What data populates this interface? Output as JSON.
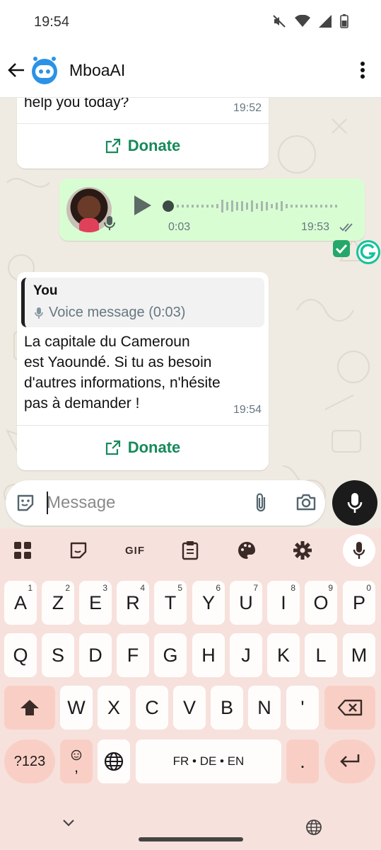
{
  "status_bar": {
    "time": "19:54"
  },
  "header": {
    "title": "MboaAI"
  },
  "messages": {
    "first": {
      "text_fragment": "help you today?",
      "time": "19:52",
      "donate_label": "Donate"
    },
    "voice": {
      "duration": "0:03",
      "time": "19:53"
    },
    "reply": {
      "quote_author": "You",
      "quote_text": "Voice message (0:03)",
      "lines": [
        "La capitale du Cameroun",
        "est Yaoundé. Si tu as besoin",
        "d'autres informations, n'hésite",
        "pas à demander !"
      ],
      "time": "19:54",
      "donate_label": "Donate"
    }
  },
  "composer": {
    "placeholder": "Message"
  },
  "keyboard": {
    "toolbar_gif": "GIF",
    "row1": [
      {
        "k": "A",
        "h": "1"
      },
      {
        "k": "Z",
        "h": "2"
      },
      {
        "k": "E",
        "h": "3"
      },
      {
        "k": "R",
        "h": "4"
      },
      {
        "k": "T",
        "h": "5"
      },
      {
        "k": "Y",
        "h": "6"
      },
      {
        "k": "U",
        "h": "7"
      },
      {
        "k": "I",
        "h": "8"
      },
      {
        "k": "O",
        "h": "9"
      },
      {
        "k": "P",
        "h": "0"
      }
    ],
    "row2": [
      "Q",
      "S",
      "D",
      "F",
      "G",
      "H",
      "J",
      "K",
      "L",
      "M"
    ],
    "row3": [
      "W",
      "X",
      "C",
      "V",
      "B",
      "N",
      "'"
    ],
    "symbols_label": "?123",
    "comma_label": ",",
    "space_label": "FR • DE • EN",
    "period_label": "."
  },
  "colors": {
    "accent_green": "#168a5a",
    "outgoing_bubble": "#d9fdd3",
    "chat_bg": "#efeae2",
    "keyboard_bg": "#f7e1dc",
    "special_key": "#f9cfc5"
  }
}
